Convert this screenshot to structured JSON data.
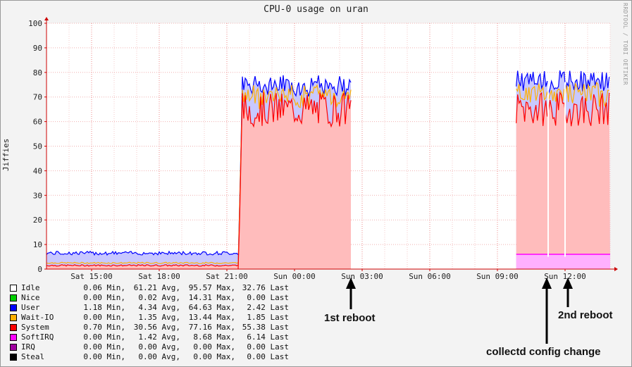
{
  "chart_data": {
    "type": "area",
    "title": "CPU-0 usage on uran",
    "ylabel": "Jiffies",
    "watermark": "RRDTOOL / TOBI OETIKER",
    "ylim": [
      0,
      100
    ],
    "yticks": [
      0,
      10,
      20,
      30,
      40,
      50,
      60,
      70,
      80,
      90,
      100
    ],
    "xticks": [
      "Sat 15:00",
      "Sat 18:00",
      "Sat 21:00",
      "Sun 00:00",
      "Sun 03:00",
      "Sun 06:00",
      "Sun 09:00",
      "Sun 12:00"
    ],
    "xlim": [
      "Sat 13:00",
      "Sun 14:00"
    ],
    "grid": true,
    "series": [
      {
        "name": "Idle",
        "color": "#ffffff"
      },
      {
        "name": "Nice",
        "color": "#00d000"
      },
      {
        "name": "User",
        "color": "#0000ff"
      },
      {
        "name": "Wait-IO",
        "color": "#ffb000"
      },
      {
        "name": "System",
        "color": "#ff0000"
      },
      {
        "name": "SoftIRQ",
        "color": "#ff00ff"
      },
      {
        "name": "IRQ",
        "color": "#a000a0"
      },
      {
        "name": "Steal",
        "color": "#000000"
      }
    ],
    "segments": [
      {
        "from": "Sat 13:00",
        "to": "Sat 21:30",
        "system": 1.5,
        "waitio": 2,
        "user": 6.5
      },
      {
        "from": "Sat 21:30",
        "to": "Sun 02:30",
        "system": 65,
        "waitio": 70,
        "user": 74
      },
      {
        "from": "Sun 09:50",
        "to": "Sun 14:00",
        "system": 65,
        "waitio": 71,
        "user": 76,
        "softirq": 6
      }
    ],
    "legend": [
      {
        "name": "Idle",
        "min": "0.06 Min,",
        "avg": "61.21 Avg,",
        "max": "95.57 Max,",
        "last": "32.76 Last"
      },
      {
        "name": "Nice",
        "min": "0.00 Min,",
        "avg": "0.02 Avg,",
        "max": "14.31 Max,",
        "last": "0.00 Last"
      },
      {
        "name": "User",
        "min": "1.18 Min,",
        "avg": "4.34 Avg,",
        "max": "64.63 Max,",
        "last": "2.42 Last"
      },
      {
        "name": "Wait-IO",
        "min": "0.00 Min,",
        "avg": "1.35 Avg,",
        "max": "13.44 Max,",
        "last": "1.85 Last"
      },
      {
        "name": "System",
        "min": "0.70 Min,",
        "avg": "30.56 Avg,",
        "max": "77.16 Max,",
        "last": "55.38 Last"
      },
      {
        "name": "SoftIRQ",
        "min": "0.00 Min,",
        "avg": "1.42 Avg,",
        "max": "8.68 Max,",
        "last": "6.14 Last"
      },
      {
        "name": "IRQ",
        "min": "0.00 Min,",
        "avg": "0.00 Avg,",
        "max": "0.00 Max,",
        "last": "0.00 Last"
      },
      {
        "name": "Steal",
        "min": "0.00 Min,",
        "avg": "0.00 Avg,",
        "max": "0.00 Max,",
        "last": "0.00 Last"
      }
    ],
    "annotations": [
      {
        "text": "1st reboot",
        "at": "Sun 02:45"
      },
      {
        "text": "collectd config change",
        "at": "Sun 11:15"
      },
      {
        "text": "2nd reboot",
        "at": "Sun 12:00"
      }
    ]
  }
}
